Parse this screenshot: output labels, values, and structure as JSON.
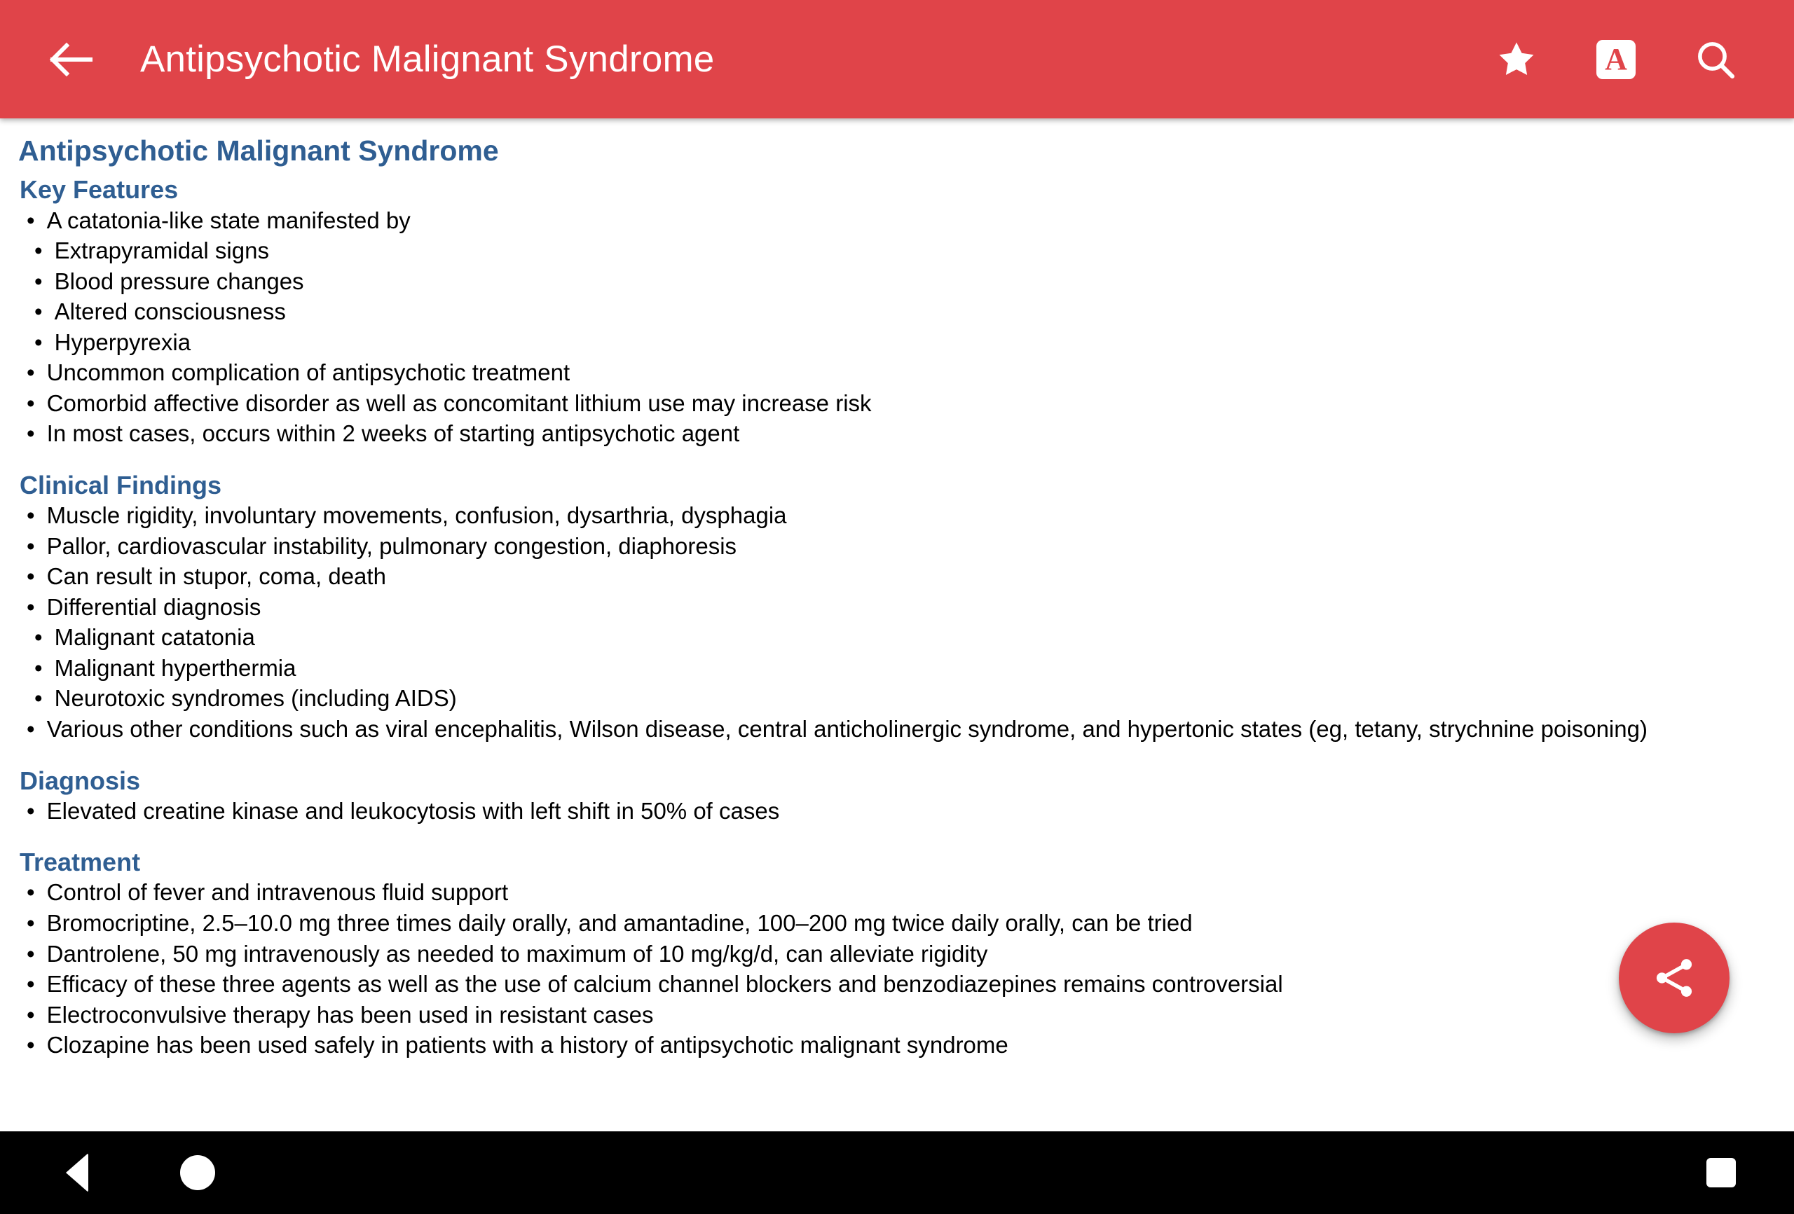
{
  "appbar": {
    "title": "Antipsychotic Malignant Syndrome",
    "back_label": "Back",
    "bookmark_label": "Bookmark",
    "font_size_label": "A",
    "search_label": "Search",
    "background_color": "#E04449"
  },
  "document": {
    "title": "Antipsychotic Malignant Syndrome",
    "heading_color": "#2F5E92",
    "sections": [
      {
        "heading": "Key Features",
        "items": [
          {
            "level": 1,
            "text": "A catatonia-like state manifested by"
          },
          {
            "level": 2,
            "text": "Extrapyramidal signs"
          },
          {
            "level": 2,
            "text": "Blood pressure changes"
          },
          {
            "level": 2,
            "text": "Altered consciousness"
          },
          {
            "level": 2,
            "text": "Hyperpyrexia"
          },
          {
            "level": 1,
            "text": "Uncommon complication of antipsychotic treatment"
          },
          {
            "level": 1,
            "text": "Comorbid affective disorder as well as concomitant lithium use may increase risk"
          },
          {
            "level": 1,
            "text": "In most cases, occurs within 2 weeks of starting antipsychotic agent"
          }
        ]
      },
      {
        "heading": "Clinical Findings",
        "items": [
          {
            "level": 1,
            "text": "Muscle rigidity, involuntary movements, confusion, dysarthria, dysphagia"
          },
          {
            "level": 1,
            "text": "Pallor, cardiovascular instability, pulmonary congestion, diaphoresis"
          },
          {
            "level": 1,
            "text": "Can result in stupor, coma, death"
          },
          {
            "level": 1,
            "text": "Differential diagnosis"
          },
          {
            "level": 2,
            "text": "Malignant catatonia"
          },
          {
            "level": 2,
            "text": "Malignant hyperthermia"
          },
          {
            "level": 2,
            "text": "Neurotoxic syndromes (including AIDS)"
          },
          {
            "level": 1,
            "text": "Various other conditions such as viral encephalitis, Wilson disease, central anticholinergic syndrome, and hypertonic states (eg, tetany, strychnine poisoning)"
          }
        ]
      },
      {
        "heading": "Diagnosis",
        "items": [
          {
            "level": 1,
            "text": "Elevated creatine kinase and leukocytosis with left shift in 50% of cases"
          }
        ]
      },
      {
        "heading": "Treatment",
        "items": [
          {
            "level": 1,
            "text": "Control of fever and intravenous fluid support"
          },
          {
            "level": 1,
            "text": "Bromocriptine, 2.5–10.0 mg three times daily orally, and amantadine, 100–200 mg twice daily orally, can be tried"
          },
          {
            "level": 1,
            "text": "Dantrolene, 50 mg intravenously as needed to maximum of 10 mg/kg/d, can alleviate rigidity"
          },
          {
            "level": 1,
            "text": "Efficacy of these three agents as well as the use of calcium channel blockers and benzodiazepines remains controversial"
          },
          {
            "level": 1,
            "text": "Electroconvulsive therapy has been used in resistant cases"
          },
          {
            "level": 1,
            "text": "Clozapine has been used safely in patients with a history of antipsychotic malignant syndrome"
          }
        ]
      }
    ],
    "bullet_glyph": "•"
  },
  "fab": {
    "label": "Share",
    "color": "#E04449"
  },
  "navbar": {
    "background_color": "#000000",
    "back_label": "Back",
    "home_label": "Home",
    "recents_label": "Recents"
  }
}
